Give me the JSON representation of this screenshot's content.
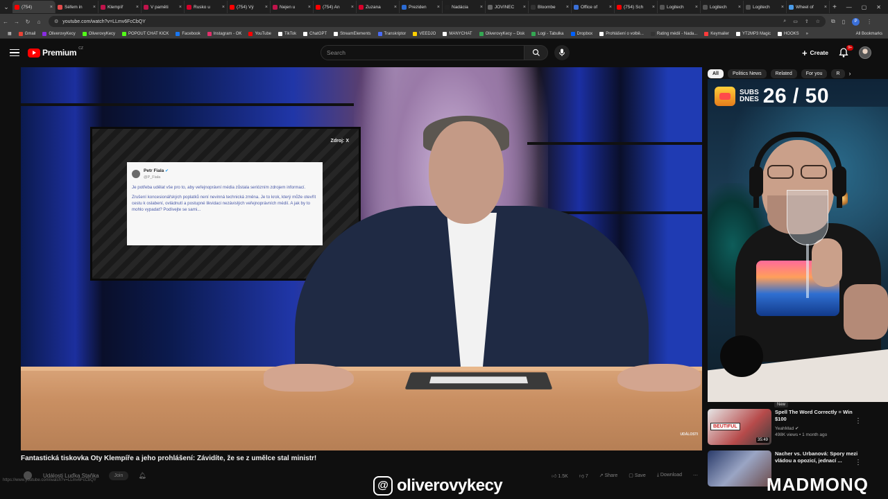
{
  "browser": {
    "tabs": [
      {
        "label": "(754)",
        "color": "#ff0000",
        "active": true
      },
      {
        "label": "Šéfem in",
        "color": "#e34b4b"
      },
      {
        "label": "Klempíř",
        "color": "#c0134b"
      },
      {
        "label": "V paměti",
        "color": "#c0134b"
      },
      {
        "label": "Rusko u",
        "color": "#d6002a"
      },
      {
        "label": "(754) Vý",
        "color": "#ff0000"
      },
      {
        "label": "Nejen u",
        "color": "#c0134b"
      },
      {
        "label": "(754) An",
        "color": "#ff0000"
      },
      {
        "label": "Zuzana",
        "color": "#d6002a"
      },
      {
        "label": "Preziden",
        "color": "#2b6bd3"
      },
      {
        "label": "Nadácia",
        "color": "#222222"
      },
      {
        "label": "JOVINEC",
        "color": "#666666"
      },
      {
        "label": "Bloombe",
        "color": "#333333"
      },
      {
        "label": "Office of",
        "color": "#3a6fd8"
      },
      {
        "label": "(754) Sch",
        "color": "#ff0000"
      },
      {
        "label": "Logitech",
        "color": "#555555"
      },
      {
        "label": "Logitech",
        "color": "#555555"
      },
      {
        "label": "Logitech",
        "color": "#555555"
      },
      {
        "label": "Wheel of",
        "color": "#4a9be8"
      }
    ],
    "url": "youtube.com/watch?v=LLmv6FcCbQY",
    "bookmarks": [
      {
        "label": "Gmail",
        "color": "#ea4335"
      },
      {
        "label": "OliverovyKecy",
        "color": "#8a2be2"
      },
      {
        "label": "OliverovyKecy",
        "color": "#53fc18"
      },
      {
        "label": "POPOUT CHAT KICK",
        "color": "#53fc18"
      },
      {
        "label": "Facebook",
        "color": "#1877f2"
      },
      {
        "label": "Instagram - OK",
        "color": "#e1306c"
      },
      {
        "label": "YouTube",
        "color": "#ff0000"
      },
      {
        "label": "TikTok",
        "color": "#ffffff"
      },
      {
        "label": "ChatGPT",
        "color": "#ffffff"
      },
      {
        "label": "StreamElements",
        "color": "#ffffff"
      },
      {
        "label": "Transkriptor",
        "color": "#4a6cf7"
      },
      {
        "label": "VEEDJO",
        "color": "#ffd000"
      },
      {
        "label": "MANYCHAT",
        "color": "#ffffff"
      },
      {
        "label": "OliverovyKecy – Disk",
        "color": "#34a853"
      },
      {
        "label": "Logi - Tabulka",
        "color": "#34a853"
      },
      {
        "label": "Dropbox",
        "color": "#0061ff"
      },
      {
        "label": "Prohlášení o volbě...",
        "color": "#ffffff"
      },
      {
        "label": "Rating médií - Nada...",
        "color": "#333333"
      },
      {
        "label": "Keymailer",
        "color": "#ff3b3b"
      },
      {
        "label": "YT2MP3 Magic",
        "color": "#ffffff"
      },
      {
        "label": "HOOKS",
        "color": "#ffffff"
      }
    ],
    "all_bookmarks": "All Bookmarks"
  },
  "youtube": {
    "logo_text": "Premium",
    "logo_country": "CZ",
    "search_placeholder": "Search",
    "create_label": "Create",
    "notif_badge": "9+",
    "chips": [
      "All",
      "Politics News",
      "Related",
      "For you",
      "R"
    ]
  },
  "video": {
    "tv_source": "Zdroj: X",
    "tweet": {
      "name": "Petr Fiala",
      "handle": "@P_Fiala",
      "para1": "Je potřeba udělat vše pro to, aby veřejnoprávní média zůstala seriózním zdrojem informací.",
      "para2": "Zrušení koncesionářských poplatků není nevinná technická změna. Je to krok, který může otevřít cestu k oslabení, ovládnutí a postupné likvidaci nezávislých veřejnoprávních médií. A jak by to mohlo vypadat? Podívejte se sami..."
    },
    "watermark": "UDÁLOSTI",
    "title": "Fantastická tiskovka Oty Klempíře a jeho prohlášení: Závidíte, že se z umělce stal ministr!",
    "channel": "Události Luďka Staňka",
    "join": "Join",
    "actions": [
      "1.5K",
      "7",
      "Share",
      "Save",
      "Download",
      "⋯"
    ]
  },
  "stream": {
    "subs_label_1": "SUBS",
    "subs_label_2": "DNES",
    "subs_count": "26 / 50",
    "threads_handle": "oliverovykecy",
    "sponsor": "MADMONQ"
  },
  "recommendations": [
    {
      "title": "Spell The Word Correctly = Win $100",
      "channel": "YeahMad",
      "views": "498K views • 1 month ago",
      "duration": "35:49",
      "thumb_label": "BEUTIFUL",
      "badge": "New"
    },
    {
      "title": "Nacher vs. Urbanová: Spory mezi vládou a opozicí, jednací ...",
      "channel": "",
      "views": "",
      "duration": "",
      "thumb_label": "",
      "badge": ""
    }
  ],
  "status_url": "https://www.youtube.com/watch?v=LLmv6FcCbQY"
}
